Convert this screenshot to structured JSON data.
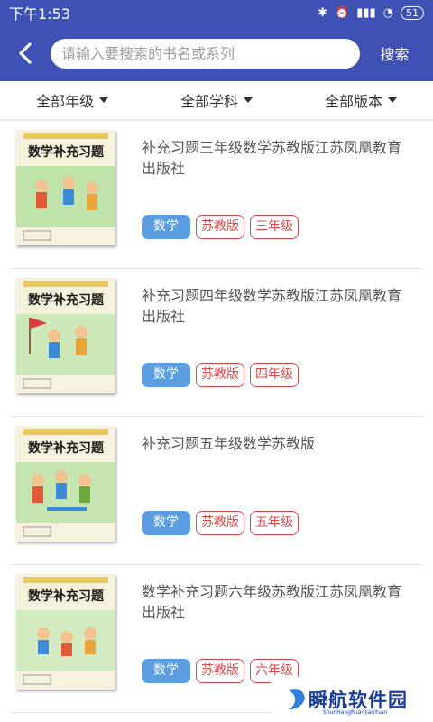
{
  "status": {
    "time": "下午1:53",
    "battery": "51"
  },
  "header": {
    "search_placeholder": "请输入要搜索的书名或系列",
    "search_button": "搜索"
  },
  "filters": [
    "全部年级",
    "全部学科",
    "全部版本"
  ],
  "books": [
    {
      "title": "补充习题三年级数学苏教版江苏凤凰教育出版社",
      "subject": "数学",
      "edition": "苏教版",
      "grade": "三年级",
      "cover_title": "数学补充习题"
    },
    {
      "title": "补充习题四年级数学苏教版江苏凤凰教育出版社",
      "subject": "数学",
      "edition": "苏教版",
      "grade": "四年级",
      "cover_title": "数学补充习题"
    },
    {
      "title": "补充习题五年级数学苏教版",
      "subject": "数学",
      "edition": "苏教版",
      "grade": "五年级",
      "cover_title": "数学补充习题"
    },
    {
      "title": "数学补充习题六年级苏教版江苏凤凰教育出版社",
      "subject": "数学",
      "edition": "苏教版",
      "grade": "六年级",
      "cover_title": "数学补充习题"
    }
  ],
  "watermark": {
    "text": "瞬航软件园",
    "sub": "ShunHangRuanJianYuan"
  },
  "colors": {
    "primary": "#3f51b5",
    "tag_blue": "#5c9ce0",
    "tag_red": "#d84a4a"
  }
}
